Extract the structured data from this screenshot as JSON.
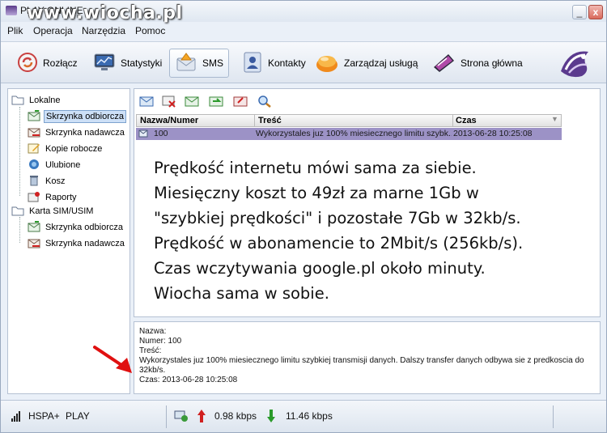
{
  "window": {
    "title": "PLAY ONLINE",
    "watermark": "www.wiocha.pl",
    "minimize_glyph": "_",
    "close_glyph": "x"
  },
  "menu": [
    "Plik",
    "Operacja",
    "Narzędzia",
    "Pomoc"
  ],
  "toolbar": [
    {
      "label": "Rozłącz",
      "icon": "disconnect-icon"
    },
    {
      "label": "Statystyki",
      "icon": "statistics-icon"
    },
    {
      "label": "SMS",
      "icon": "sms-icon",
      "active": true
    },
    {
      "label": "Kontakty",
      "icon": "contacts-icon"
    },
    {
      "label": "Zarządzaj usługą",
      "icon": "manage-service-icon"
    },
    {
      "label": "Strona główna",
      "icon": "homepage-icon"
    }
  ],
  "tree": {
    "local": {
      "label": "Lokalne",
      "items": [
        "Skrzynka odbiorcza",
        "Skrzynka nadawcza",
        "Kopie robocze",
        "Ulubione",
        "Kosz",
        "Raporty"
      ]
    },
    "sim": {
      "label": "Karta SIM/USIM",
      "items": [
        "Skrzynka odbiorcza",
        "Skrzynka nadawcza"
      ]
    },
    "selected": "Skrzynka odbiorcza"
  },
  "grid": {
    "columns": [
      "Nazwa/Numer",
      "Treść",
      "Czas"
    ],
    "rows": [
      {
        "number": "100",
        "content": "Wykorzystales juz 100% miesiecznego limitu szybk...",
        "time": "2013-06-28 10:25:08"
      }
    ]
  },
  "overlay_text": [
    "Prędkość internetu mówi sama za siebie.",
    "Miesięczny koszt to 49zł za marne 1Gb w",
    "\"szybkiej prędkości\" i pozostałe 7Gb w 32kb/s.",
    "Prędkość w abonamencie to 2Mbit/s (256kb/s).",
    "Czas wczytywania google.pl około minuty.",
    "Wiocha sama w sobie."
  ],
  "details": {
    "name": "Nazwa:",
    "number": "Numer: 100",
    "content_label": "Treść:",
    "content_line1": "Wykorzystales juz 100% miesiecznego limitu szybkiej transmisji danych. Dalszy transfer danych odbywa sie z predkoscia do",
    "content_line2": "32kb/s.",
    "time": "Czas: 2013-06-28 10:25:08"
  },
  "status": {
    "network": "HSPA+",
    "operator": "PLAY",
    "upload": "0.98 kbps",
    "download": "11.46 kbps"
  },
  "colors": {
    "selected_row": "#9c92c6",
    "annotation_arrow": "#e01010",
    "upload_arrow": "#d02020",
    "download_arrow": "#2a9a2a"
  }
}
